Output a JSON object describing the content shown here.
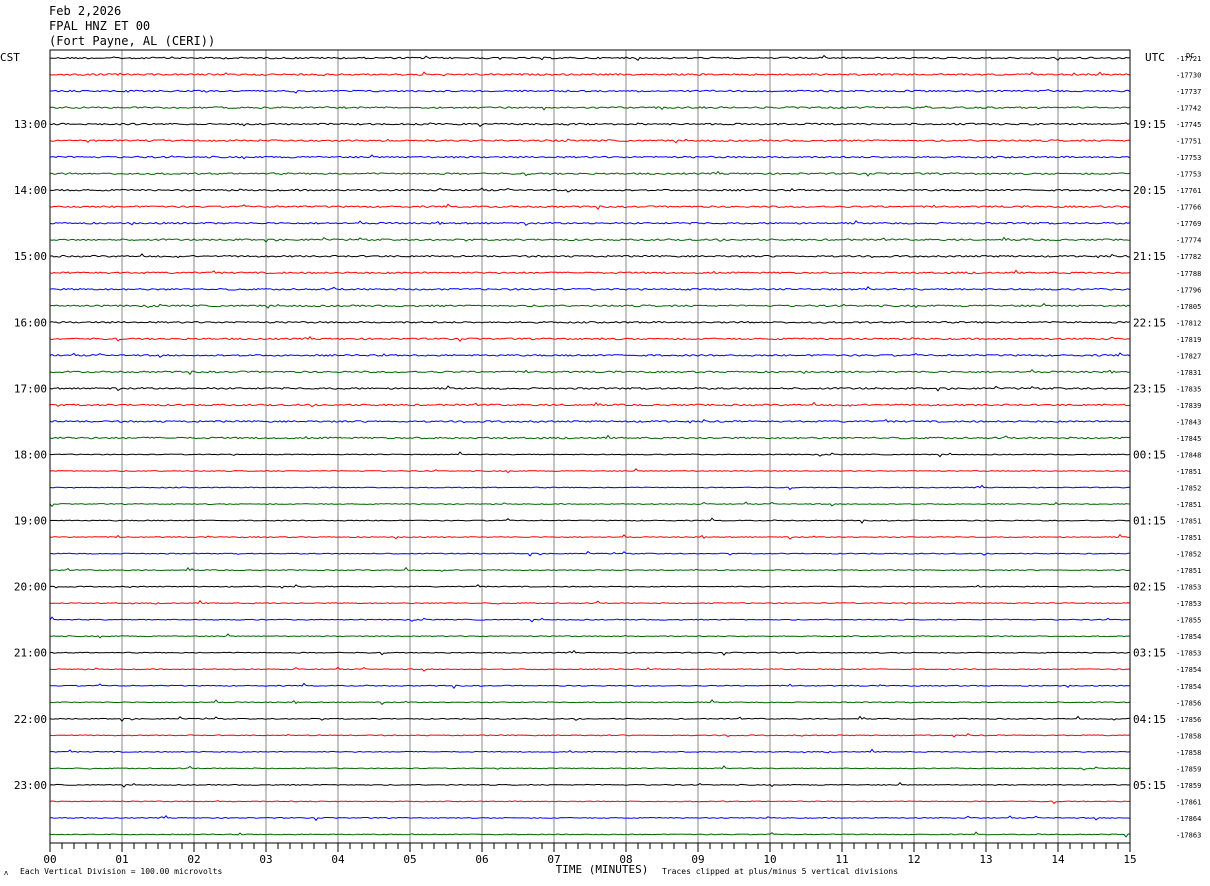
{
  "header": {
    "date": "Feb 2,2026",
    "station": "FPAL HNZ ET 00",
    "location": "(Fort Payne, AL (CERI))"
  },
  "footer": {
    "scale_note": "Each Vertical Division = 100.00 microvolts",
    "clip_note": "Traces clipped at plus/minus 5 vertical divisions",
    "corner_mark": "ʌ"
  },
  "chart_data": {
    "type": "line",
    "title": "",
    "xlabel": "TIME (MINUTES)",
    "ylabel": "",
    "left_axis_title": "CST",
    "right_axis_title": "UTC",
    "offset_column_title": "DC",
    "xlim": [
      0,
      15
    ],
    "x_ticks": [
      "00",
      "01",
      "02",
      "03",
      "04",
      "05",
      "06",
      "07",
      "08",
      "09",
      "10",
      "11",
      "12",
      "13",
      "14",
      "15"
    ],
    "trace_colors": [
      "#000000",
      "#ff0000",
      "#0000ff",
      "#006400"
    ],
    "grid": true,
    "left_labels": [
      {
        "trace": 4,
        "label": "13:00"
      },
      {
        "trace": 8,
        "label": "14:00"
      },
      {
        "trace": 12,
        "label": "15:00"
      },
      {
        "trace": 16,
        "label": "16:00"
      },
      {
        "trace": 20,
        "label": "17:00"
      },
      {
        "trace": 24,
        "label": "18:00"
      },
      {
        "trace": 28,
        "label": "19:00"
      },
      {
        "trace": 32,
        "label": "20:00"
      },
      {
        "trace": 36,
        "label": "21:00"
      },
      {
        "trace": 40,
        "label": "22:00"
      },
      {
        "trace": 44,
        "label": "23:00"
      }
    ],
    "right_labels": [
      {
        "trace": 4,
        "label": "19:15"
      },
      {
        "trace": 8,
        "label": "20:15"
      },
      {
        "trace": 12,
        "label": "21:15"
      },
      {
        "trace": 16,
        "label": "22:15"
      },
      {
        "trace": 20,
        "label": "23:15"
      },
      {
        "trace": 24,
        "label": "00:15"
      },
      {
        "trace": 28,
        "label": "01:15"
      },
      {
        "trace": 32,
        "label": "02:15"
      },
      {
        "trace": 36,
        "label": "03:15"
      },
      {
        "trace": 40,
        "label": "04:15"
      },
      {
        "trace": 44,
        "label": "05:15"
      }
    ],
    "dc_offsets": [
      "-17721",
      "-17730",
      "-17737",
      "-17742",
      "-17745",
      "-17751",
      "-17753",
      "-17753",
      "-17761",
      "-17766",
      "-17769",
      "-17774",
      "-17782",
      "-17788",
      "-17796",
      "-17805",
      "-17812",
      "-17819",
      "-17827",
      "-17831",
      "-17835",
      "-17839",
      "-17843",
      "-17845",
      "-17848",
      "-17851",
      "-17852",
      "-17851",
      "-17851",
      "-17851",
      "-17852",
      "-17851",
      "-17853",
      "-17853",
      "-17855",
      "-17854",
      "-17853",
      "-17854",
      "-17854",
      "-17856",
      "-17856",
      "-17858",
      "-17858",
      "-17859",
      "-17859",
      "-17861",
      "-17864",
      "-17863"
    ]
  }
}
